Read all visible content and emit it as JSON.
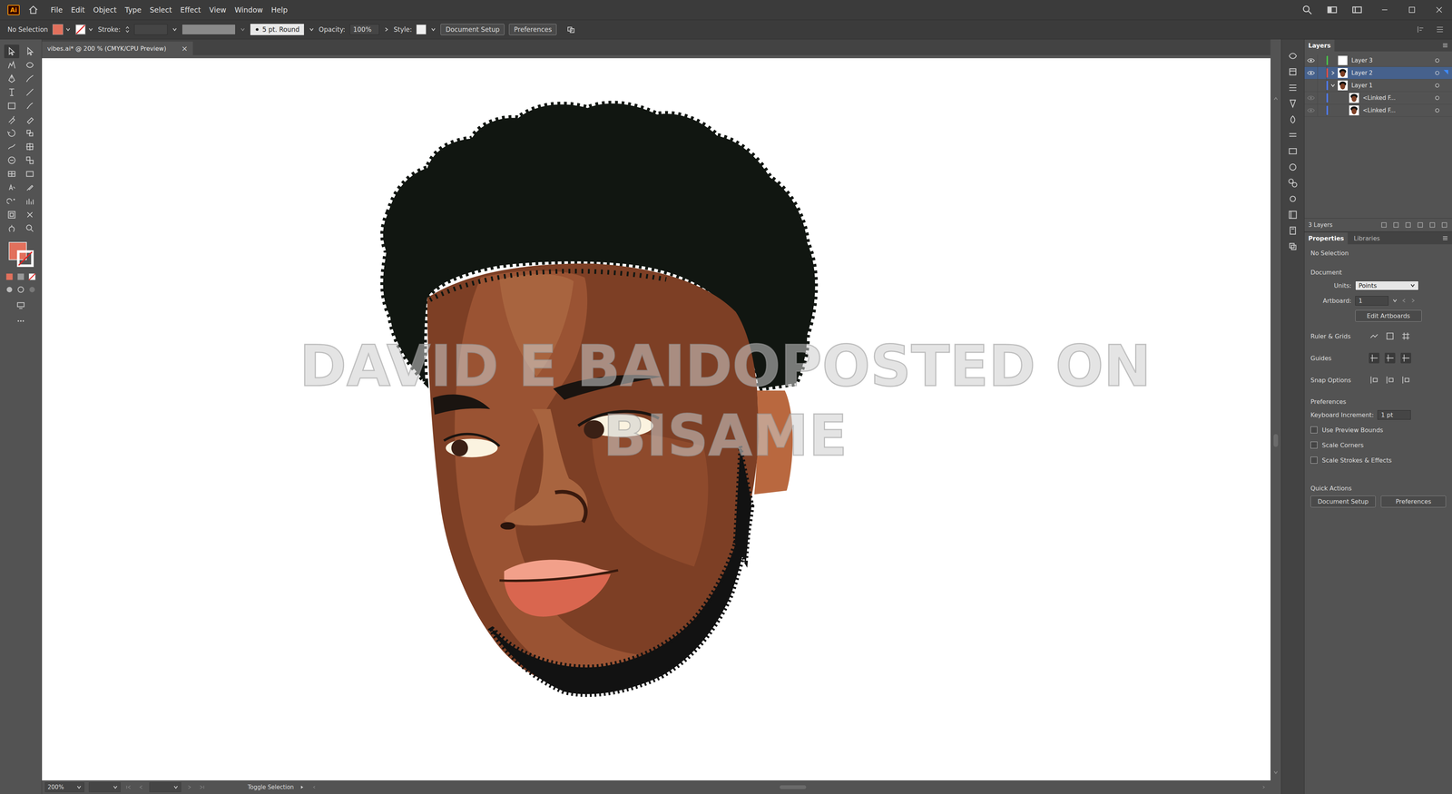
{
  "app": {
    "logo": "Ai"
  },
  "menu": [
    "File",
    "Edit",
    "Object",
    "Type",
    "Select",
    "Effect",
    "View",
    "Window",
    "Help"
  ],
  "control_bar": {
    "selection": "No Selection",
    "fill_color": "#e2705c",
    "stroke_label": "Stroke:",
    "brush": "5 pt. Round",
    "opacity_label": "Opacity:",
    "opacity": "100%",
    "style_label": "Style:",
    "buttons": [
      "Document Setup",
      "Preferences"
    ]
  },
  "document_tab": {
    "title": "vibes.ai* @ 200 % (CMYK/CPU Preview)",
    "close": "×"
  },
  "artwork": {
    "watermark": [
      "DAVID E BAIDOPOSTED ON",
      "BISAME"
    ]
  },
  "layers": {
    "title": "Layers",
    "count": "3 Layers",
    "items": [
      {
        "name": "Layer 3",
        "visible": true,
        "dimmed": false,
        "expandable": false,
        "expanded": false,
        "selected": false,
        "child": false,
        "thumbnail": "blank",
        "color": "#4cc24c"
      },
      {
        "name": "Layer 2",
        "visible": true,
        "dimmed": false,
        "expandable": true,
        "expanded": false,
        "selected": true,
        "child": false,
        "thumbnail": "portrait",
        "color": "#e0504a"
      },
      {
        "name": "Layer 1",
        "visible": false,
        "dimmed": false,
        "expandable": true,
        "expanded": true,
        "selected": false,
        "child": false,
        "thumbnail": "portrait",
        "color": "#4f7bff"
      },
      {
        "name": "<Linked F...",
        "visible": true,
        "dimmed": true,
        "expandable": false,
        "expanded": false,
        "selected": false,
        "child": true,
        "thumbnail": "portrait",
        "color": "#4f7bff"
      },
      {
        "name": "<Linked F...",
        "visible": true,
        "dimmed": true,
        "expandable": false,
        "expanded": false,
        "selected": false,
        "child": true,
        "thumbnail": "portrait",
        "color": "#4f7bff"
      }
    ]
  },
  "properties": {
    "tabs": [
      {
        "label": "Properties",
        "selected": true
      },
      {
        "label": "Libraries",
        "selected": false
      }
    ],
    "selection": "No Selection",
    "document": "Document",
    "units_label": "Units:",
    "units": "Points",
    "artboard_label": "Artboard:",
    "artboard": "1",
    "edit_artboards": "Edit Artboards",
    "ruler_grids": "Ruler & Grids",
    "guides": "Guides",
    "snap_options": "Snap Options",
    "preferences": "Preferences",
    "keyboard_label": "Keyboard Increment:",
    "keyboard": "1 pt",
    "checkboxes": [
      {
        "label": "Use Preview Bounds",
        "checked": false
      },
      {
        "label": "Scale Corners",
        "checked": false
      },
      {
        "label": "Scale Strokes & Effects",
        "checked": false
      }
    ],
    "quick_actions": "Quick Actions",
    "buttons": [
      "Document Setup",
      "Preferences"
    ]
  },
  "status_bar": {
    "zoom": "200%",
    "tool": "Toggle Selection"
  }
}
